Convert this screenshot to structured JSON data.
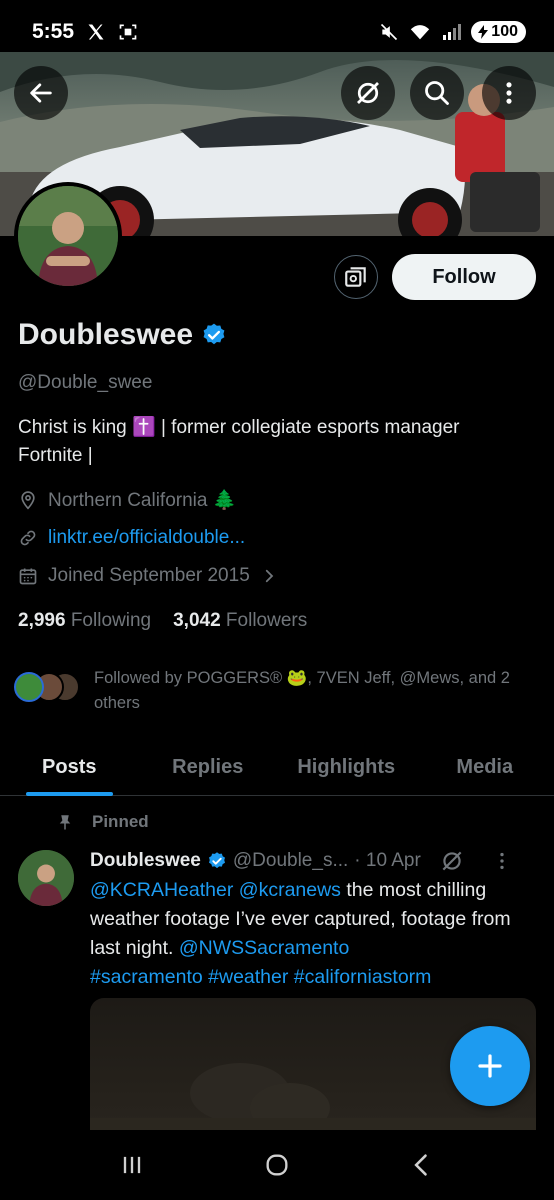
{
  "status_bar": {
    "time": "5:55",
    "battery": "100"
  },
  "profile": {
    "display_name": "Doubleswee",
    "handle": "@Double_swee",
    "bio_line1": "Christ is king ✝️ | former collegiate esports manager",
    "bio_line2": "Fortnite |",
    "location": "Northern California 🌲",
    "link": "linktr.ee/officialdouble...",
    "joined": "Joined September 2015",
    "following_count": "2,996",
    "following_label": "Following",
    "followers_count": "3,042",
    "followers_label": "Followers",
    "followed_by": "Followed by POGGERS® 🐸, 7VEN Jeff, @Mews, and 2 others",
    "follow_label": "Follow"
  },
  "tabs": [
    {
      "label": "Posts",
      "active": true
    },
    {
      "label": "Replies",
      "active": false
    },
    {
      "label": "Highlights",
      "active": false
    },
    {
      "label": "Media",
      "active": false
    }
  ],
  "pinned_post": {
    "pinned_label": "Pinned",
    "name": "Doubleswee",
    "handle": "@Double_s...",
    "date": "· 10 Apr",
    "text_1": "@KCRAHeather",
    "text_2": " ",
    "text_3": "@kcranews",
    "text_4": " the most chilling weather footage I’ve ever captured, footage from last night. ",
    "text_5": "@NWSSacramento",
    "text_6": "#sacramento #weather #californiastorm"
  },
  "colors": {
    "accent": "#1d9bf0",
    "verified": "#1d9bf0",
    "background": "#000000"
  }
}
